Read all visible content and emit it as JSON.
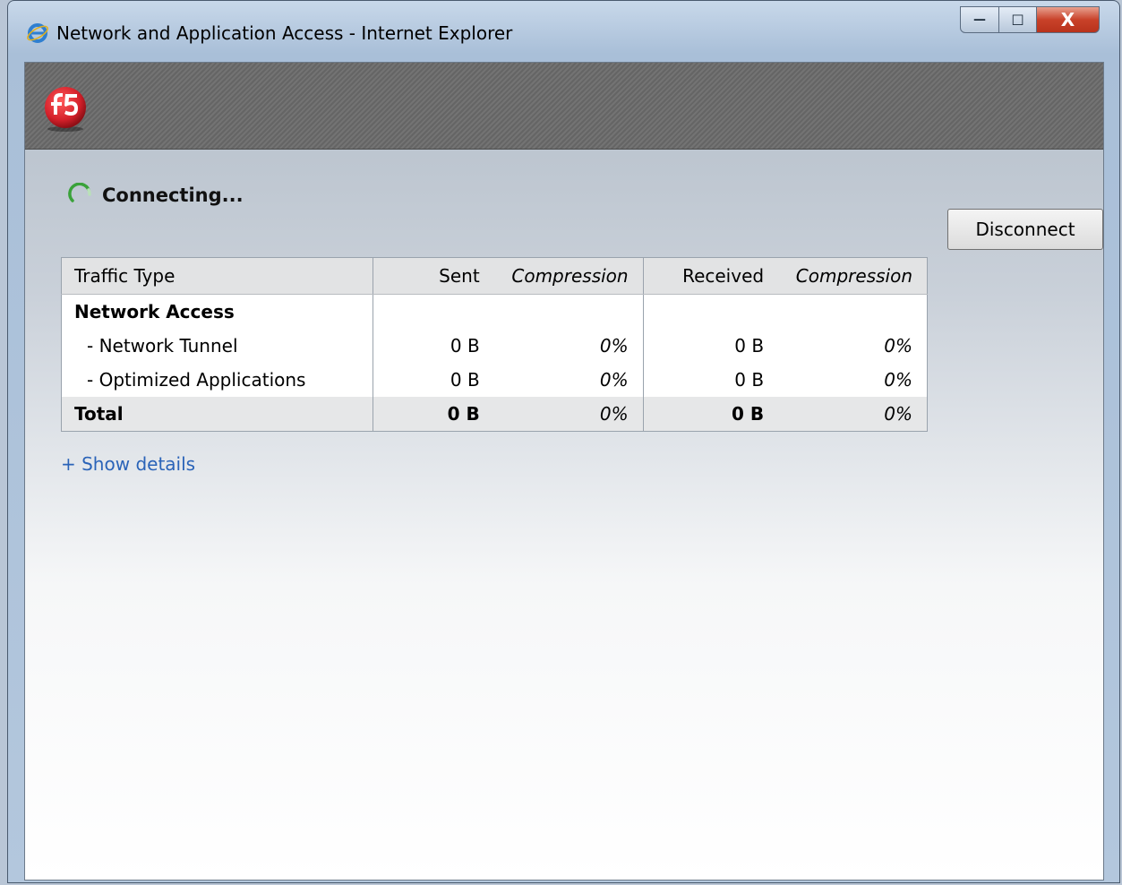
{
  "window": {
    "title": "Network and Application Access - Internet Explorer",
    "controls": {
      "minimize": "—",
      "maximize": "☐",
      "close": "X"
    }
  },
  "status": {
    "text": "Connecting..."
  },
  "disconnect_label": "Disconnect",
  "table": {
    "headers": {
      "traffic_type": "Traffic Type",
      "sent": "Sent",
      "sent_compression": "Compression",
      "received": "Received",
      "received_compression": "Compression"
    },
    "section_label": "Network Access",
    "rows": [
      {
        "label": "- Network Tunnel",
        "sent": "0 B",
        "sent_comp": "0%",
        "recv": "0 B",
        "recv_comp": "0%"
      },
      {
        "label": "- Optimized Applications",
        "sent": "0 B",
        "sent_comp": "0%",
        "recv": "0 B",
        "recv_comp": "0%"
      }
    ],
    "total": {
      "label": "Total",
      "sent": "0 B",
      "sent_comp": "0%",
      "recv": "0 B",
      "recv_comp": "0%"
    }
  },
  "show_details": "+ Show details",
  "colors": {
    "link": "#2a63b8",
    "spinner": "#3aa23a",
    "logo_red": "#d4202a",
    "close_button": "#c9422a"
  }
}
